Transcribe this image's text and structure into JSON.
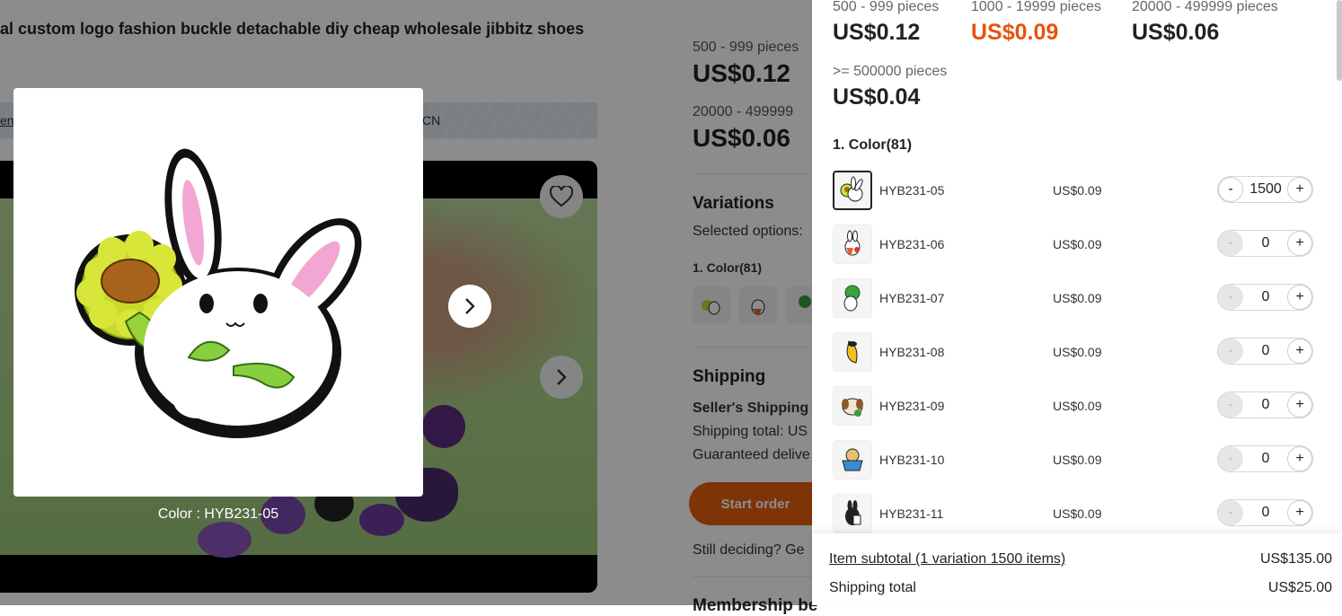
{
  "product": {
    "title_fragment": "al custom logo fashion buckle detachable diy cheap wholesale jibbitz shoes",
    "strip_link_fragment": "ene",
    "strip_origin_fragment": "CN"
  },
  "side_panel": {
    "tiers": [
      {
        "label": "500 - 999 pieces",
        "price": "US$0.12"
      },
      {
        "label": "20000 - 499999",
        "price": "US$0.06"
      }
    ],
    "variations_heading": "Variations",
    "selected_options": "Selected options:",
    "color_label": "1. Color(81)",
    "shipping_heading": "Shipping",
    "sellers_shipping": "Seller's Shipping",
    "shipping_total": "Shipping total: US",
    "guaranteed": "Guaranteed delive",
    "start_order": "Start order",
    "still_deciding": "Still deciding? Ge",
    "membership": "Membership be"
  },
  "lightbox": {
    "caption": "Color : HYB231-05"
  },
  "drawer": {
    "tiers": [
      {
        "label": "500 - 999 pieces",
        "price": "US$0.12",
        "highlight": false
      },
      {
        "label": "1000 - 19999 pieces",
        "price": "US$0.09",
        "highlight": true
      },
      {
        "label": "20000 - 499999 pieces",
        "price": "US$0.06",
        "highlight": false
      },
      {
        "label": ">= 500000 pieces",
        "price": "US$0.04",
        "highlight": false
      }
    ],
    "section_title": "1. Color(81)",
    "variants": [
      {
        "code": "HYB231-05",
        "price": "US$0.09",
        "qty": "1500",
        "selected": true,
        "icon": "bunny-sunflower-icon"
      },
      {
        "code": "HYB231-06",
        "price": "US$0.09",
        "qty": "0",
        "selected": false,
        "icon": "bunny-carrot-icon"
      },
      {
        "code": "HYB231-07",
        "price": "US$0.09",
        "qty": "0",
        "selected": false,
        "icon": "bunny-broccoli-icon"
      },
      {
        "code": "HYB231-08",
        "price": "US$0.09",
        "qty": "0",
        "selected": false,
        "icon": "bunny-banana-icon"
      },
      {
        "code": "HYB231-09",
        "price": "US$0.09",
        "qty": "0",
        "selected": false,
        "icon": "bunny-dog-icon"
      },
      {
        "code": "HYB231-10",
        "price": "US$0.09",
        "qty": "0",
        "selected": false,
        "icon": "bunny-cup-icon"
      },
      {
        "code": "HYB231-11",
        "price": "US$0.09",
        "qty": "0",
        "selected": false,
        "icon": "bunny-black-icon"
      }
    ],
    "minus_label": "-",
    "plus_label": "+",
    "subtotal_label": "Item subtotal (1 variation 1500 items)",
    "subtotal_value": "US$135.00",
    "shipping_label": "Shipping total",
    "shipping_value": "US$25.00"
  },
  "colors": {
    "accent": "#e8600f",
    "price_highlight": "#e8520f"
  }
}
